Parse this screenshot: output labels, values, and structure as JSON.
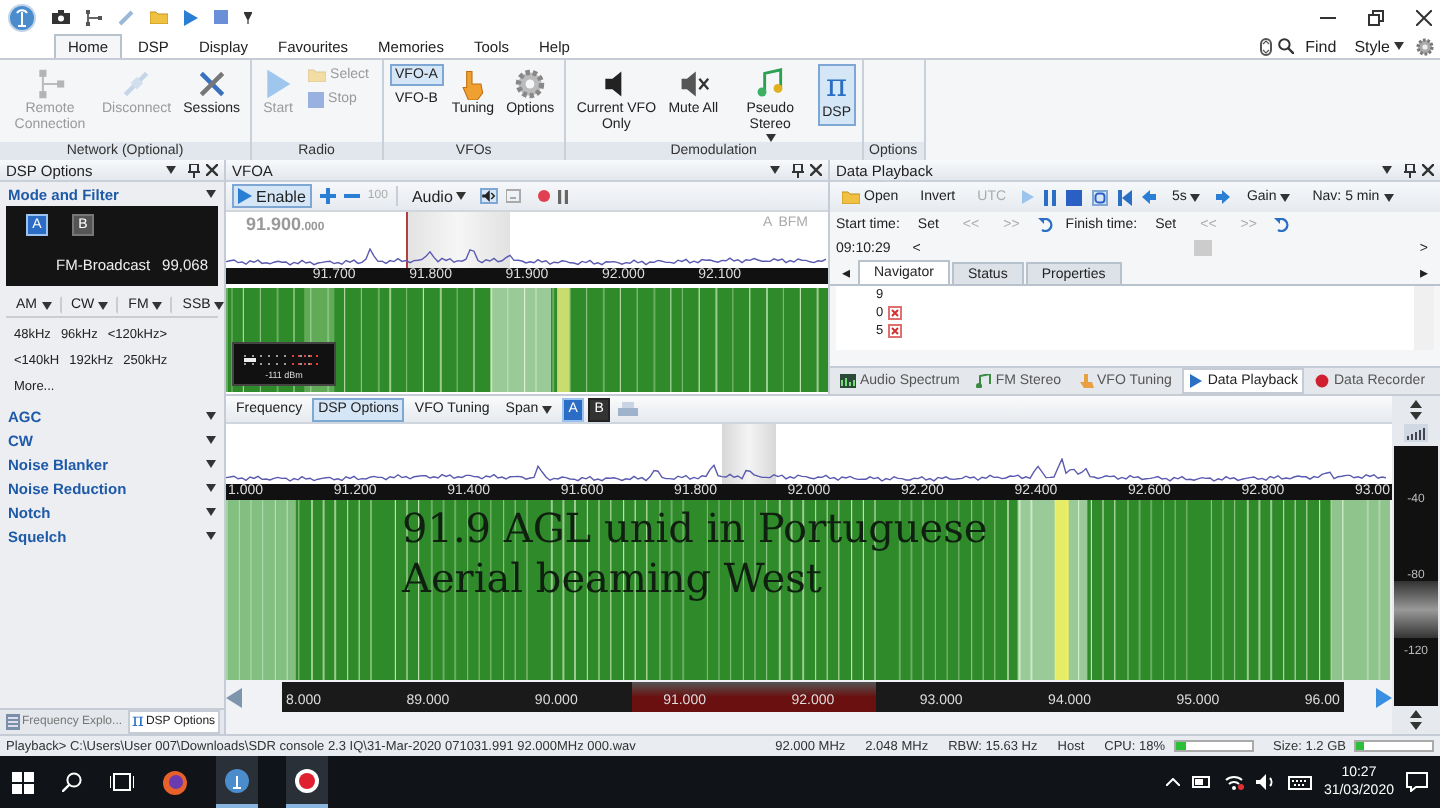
{
  "ribbon": {
    "tabs": [
      {
        "label": "Home",
        "selected": true
      },
      {
        "label": "DSP",
        "selected": false
      },
      {
        "label": "Display",
        "selected": false
      },
      {
        "label": "Favourites",
        "selected": false
      },
      {
        "label": "Memories",
        "selected": false
      },
      {
        "label": "Tools",
        "selected": false
      },
      {
        "label": "Help",
        "selected": false
      }
    ],
    "find": "Find",
    "style": "Style",
    "groups": [
      {
        "label": "Network (Optional)",
        "items": [
          {
            "kind": "large",
            "label": "Remote Connection",
            "disabled": true
          },
          {
            "kind": "large",
            "label": "Disconnect",
            "disabled": true
          },
          {
            "kind": "large",
            "label": "Sessions",
            "disabled": false
          }
        ]
      },
      {
        "label": "Radio",
        "items": [
          {
            "kind": "large",
            "label": "Start",
            "disabled": true
          },
          {
            "kind": "small",
            "label": "Select",
            "disabled": true
          },
          {
            "kind": "small",
            "label": "Stop",
            "disabled": true
          }
        ]
      },
      {
        "label": "VFOs",
        "items": [
          {
            "kind": "small",
            "label": "VFO-A",
            "selected": true
          },
          {
            "kind": "small",
            "label": "VFO-B",
            "selected": false
          },
          {
            "kind": "large",
            "label": "Tuning"
          },
          {
            "kind": "large",
            "label": "Options"
          }
        ]
      },
      {
        "label": "Demodulation",
        "items": [
          {
            "kind": "large",
            "label": "Current VFO Only",
            "selected": false
          },
          {
            "kind": "large",
            "label": "Mute All",
            "selected": false
          },
          {
            "kind": "large",
            "label": "Pseudo Stereo",
            "selected": false,
            "dropdown": true
          },
          {
            "kind": "large",
            "label": "DSP",
            "glyph": "π",
            "selected": true
          }
        ]
      },
      {
        "label": "Options"
      }
    ]
  },
  "dsp_panel": {
    "title": "DSP Options",
    "mode_filter": {
      "title": "Mode and Filter",
      "vfos": [
        {
          "label": "A",
          "selected": true
        },
        {
          "label": "B",
          "selected": false
        }
      ],
      "mode": "FM-Broadcast",
      "frequency": "99,068",
      "modes": [
        "AM",
        "CW",
        "FM",
        "SSB"
      ],
      "bandwidths": [
        "48kHz",
        "96kHz",
        "<120kHz>",
        "<140kH",
        "192kHz",
        "250kHz",
        "More..."
      ]
    },
    "sections": [
      "AGC",
      "CW",
      "Noise Blanker",
      "Noise Reduction",
      "Notch",
      "Squelch"
    ],
    "bottom_tabs": [
      {
        "label": "Frequency Explo...",
        "selected": false
      },
      {
        "label": "DSP Options",
        "glyph": "π",
        "selected": true
      }
    ]
  },
  "vfo_panel": {
    "title": "VFOA",
    "enable": "Enable",
    "step": "100",
    "audio": "Audio",
    "readout": "91.900",
    "readout_fraction": ".000",
    "vfo": "A",
    "mode": "BFM",
    "axis": [
      "91.700",
      "91.800",
      "91.900",
      "92.000",
      "92.100"
    ],
    "meter_reading": "-111 dBm"
  },
  "playback_panel": {
    "title": "Data Playback",
    "open": "Open",
    "invert": "Invert",
    "utc": "UTC",
    "skip": "5s",
    "gain": "Gain",
    "nav": "Nav: 5 min",
    "start_label": "Start time:",
    "finish_label": "Finish time:",
    "start_set": "Set",
    "start_back": "<<",
    "start_forward": ">>",
    "finish_set": "Set",
    "finish_back": "<<",
    "finish_forward": ">>",
    "time": "09:10:29",
    "prev": "<",
    "next": ">",
    "tabs": [
      {
        "label": "Navigator",
        "selected": true
      },
      {
        "label": "Status",
        "selected": false
      },
      {
        "label": "Properties",
        "selected": false
      }
    ],
    "tab_left": "◂",
    "tab_right": "▸",
    "entries": [
      "9",
      "0",
      "5"
    ],
    "bottom_tabs": [
      {
        "label": "Audio Spectrum",
        "selected": false
      },
      {
        "label": "FM Stereo",
        "selected": false
      },
      {
        "label": "VFO Tuning",
        "selected": false
      },
      {
        "label": "Data Playback",
        "selected": true
      },
      {
        "label": "Data Recorder",
        "selected": false
      }
    ]
  },
  "spectrum": {
    "toolbar": [
      {
        "label": "Frequency",
        "selected": false
      },
      {
        "label": "DSP Options",
        "selected": true
      },
      {
        "label": "VFO Tuning",
        "selected": false
      }
    ],
    "span": "Span",
    "vfos": [
      {
        "label": "A",
        "selected": true
      },
      {
        "label": "B",
        "selected": false
      }
    ],
    "axis": [
      "1.000",
      "91.200",
      "91.400",
      "91.600",
      "91.800",
      "92.000",
      "92.200",
      "92.400",
      "92.600",
      "92.800",
      "93.00"
    ],
    "annotation": [
      "91.9 AGL unid in Portuguese",
      "Aerial beaming West"
    ],
    "scale": [
      "-40",
      "-80",
      "-120"
    ],
    "overview_axis": [
      "8.000",
      "89.000",
      "90.000",
      "91.000",
      "92.000",
      "93.000",
      "94.000",
      "95.000",
      "96.00"
    ]
  },
  "status_bar": {
    "path": "Playback> C:\\Users\\User 007\\Downloads\\SDR console 2.3 IQ\\31-Mar-2020 071031.991 92.000MHz 000.wav",
    "frequency": "92.000 MHz",
    "bandwidth": "2.048 MHz",
    "rbw": "RBW: 15.63 Hz",
    "host": "Host",
    "cpu": {
      "label": "CPU: 18%",
      "level": 0.15
    },
    "size": {
      "label": "Size: 1.2 GB",
      "level": 0.1
    }
  },
  "taskbar": {
    "time": "10:27",
    "date": "31/03/2020"
  }
}
